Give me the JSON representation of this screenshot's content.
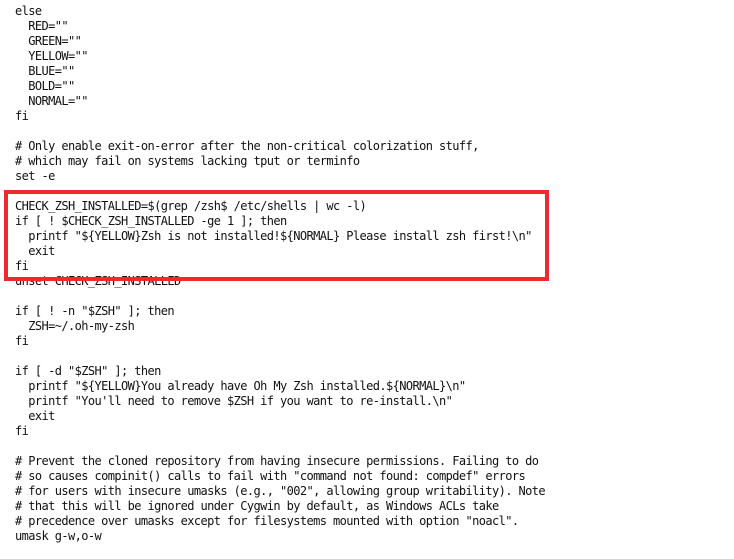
{
  "editor": {
    "lines": [
      "else",
      "  RED=\"\"",
      "  GREEN=\"\"",
      "  YELLOW=\"\"",
      "  BLUE=\"\"",
      "  BOLD=\"\"",
      "  NORMAL=\"\"",
      "fi",
      "",
      "# Only enable exit-on-error after the non-critical colorization stuff,",
      "# which may fail on systems lacking tput or terminfo",
      "set -e",
      "",
      "CHECK_ZSH_INSTALLED=$(grep /zsh$ /etc/shells | wc -l)",
      "if [ ! $CHECK_ZSH_INSTALLED -ge 1 ]; then",
      "  printf \"${YELLOW}Zsh is not installed!${NORMAL} Please install zsh first!\\n\"",
      "  exit",
      "fi",
      "unset CHECK_ZSH_INSTALLED",
      "",
      "if [ ! -n \"$ZSH\" ]; then",
      "  ZSH=~/.oh-my-zsh",
      "fi",
      "",
      "if [ -d \"$ZSH\" ]; then",
      "  printf \"${YELLOW}You already have Oh My Zsh installed.${NORMAL}\\n\"",
      "  printf \"You'll need to remove $ZSH if you want to re-install.\\n\"",
      "  exit",
      "fi",
      "",
      "# Prevent the cloned repository from having insecure permissions. Failing to do",
      "# so causes compinit() calls to fail with \"command not found: compdef\" errors",
      "# for users with insecure umasks (e.g., \"002\", allowing group writability). Note",
      "# that this will be ignored under Cygwin by default, as Windows ACLs take",
      "# precedence over umasks except for filesystems mounted with option \"noacl\".",
      "umask g-w,o-w"
    ]
  },
  "annotation": {
    "color": "#ee2a2f"
  }
}
